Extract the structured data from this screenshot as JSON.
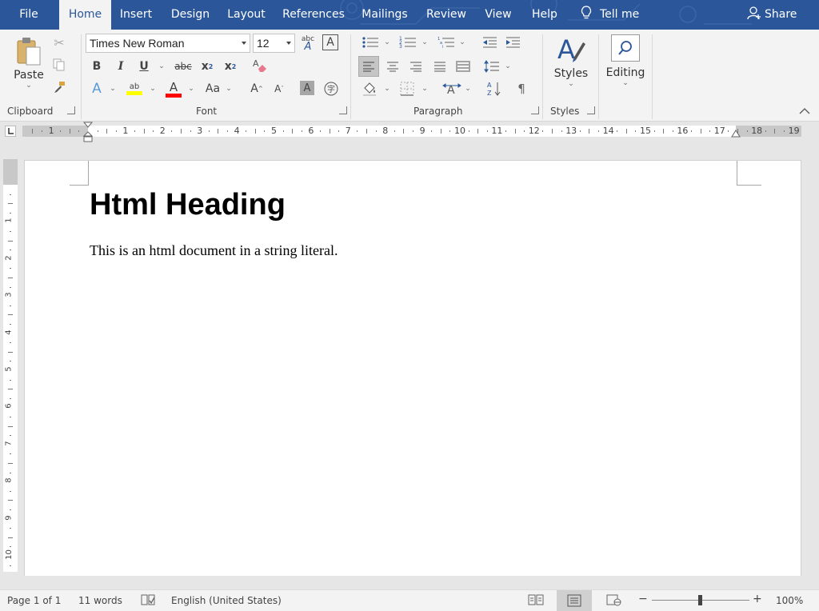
{
  "menu": {
    "tabs": [
      "File",
      "Home",
      "Insert",
      "Design",
      "Layout",
      "References",
      "Mailings",
      "Review",
      "View",
      "Help"
    ],
    "active_tab": "Home",
    "tell_me": "Tell me",
    "share": "Share"
  },
  "ribbon": {
    "clipboard": {
      "paste_label": "Paste",
      "group_label": "Clipboard"
    },
    "font": {
      "font_name": "Times New Roman",
      "font_size": "12",
      "bold": "B",
      "italic": "I",
      "underline": "U",
      "strikethrough": "abc",
      "subscript": "x",
      "subscript_small": "2",
      "superscript": "x",
      "superscript_small": "2",
      "font_effects": "A",
      "highlight": "ab",
      "font_color": "A",
      "change_case": "Aa",
      "grow": "A",
      "shrink": "A",
      "shading": "A",
      "group_label": "Font",
      "highlight_color": "#ffff00",
      "font_color_value": "#ff0000"
    },
    "paragraph": {
      "group_label": "Paragraph"
    },
    "styles": {
      "styles_label": "Styles",
      "group_label": "Styles"
    },
    "editing": {
      "editing_label": "Editing"
    }
  },
  "ruler": {
    "numbers": [
      "1",
      "1",
      "2",
      "3",
      "4",
      "5",
      "6",
      "7",
      "8",
      "9",
      "10",
      "11",
      "12",
      "13",
      "14",
      "15",
      "16",
      "17",
      "18",
      "19"
    ],
    "vertical_numbers": [
      "1",
      "2",
      "3",
      "4",
      "5",
      "6",
      "7",
      "8",
      "9",
      "10"
    ]
  },
  "document": {
    "heading": "Html Heading",
    "paragraph": "This is an html document in a string literal."
  },
  "status": {
    "page": "Page 1 of 1",
    "words": "11 words",
    "language": "English (United States)",
    "zoom": "100%",
    "minus": "−",
    "plus": "+"
  },
  "colors": {
    "brand": "#2b579a",
    "ribbon_bg": "#f3f3f3",
    "canvas_bg": "#e6e6e6"
  }
}
